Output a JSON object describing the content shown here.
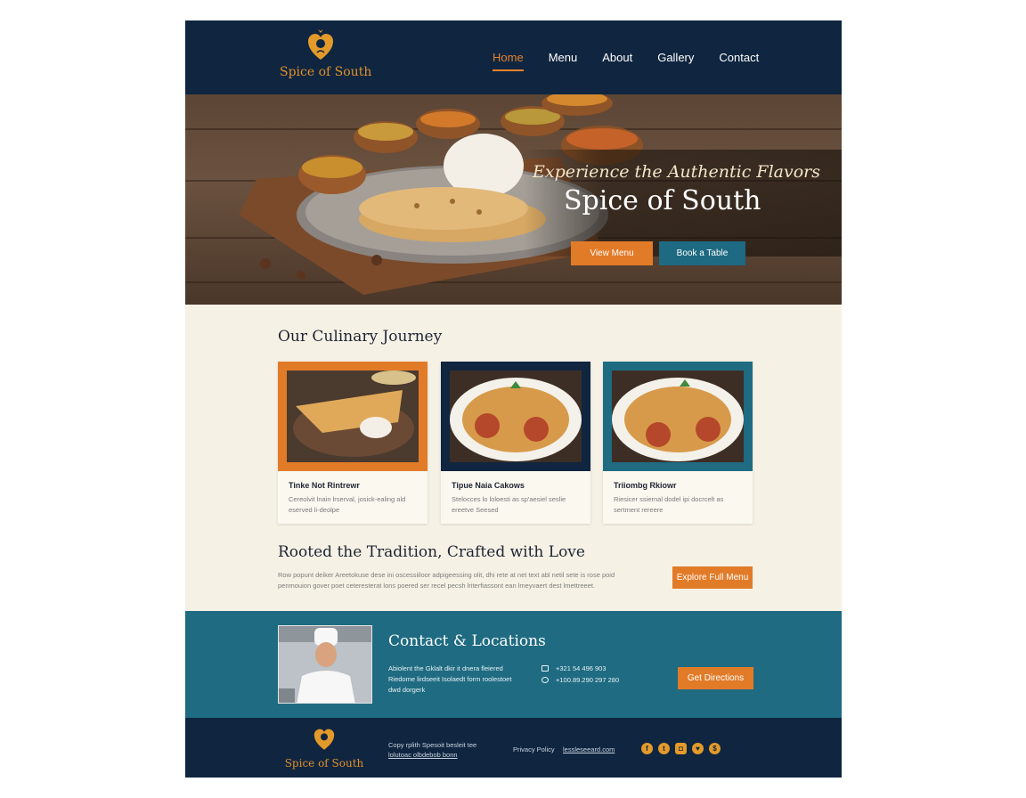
{
  "brand": {
    "name": "Spice of South"
  },
  "nav": {
    "items": [
      {
        "label": "Home",
        "active": true
      },
      {
        "label": "Menu"
      },
      {
        "label": "About"
      },
      {
        "label": "Gallery"
      },
      {
        "label": "Contact"
      }
    ]
  },
  "hero": {
    "tagline": "Experience the Authentic Flavors",
    "title": "Spice of South",
    "view_menu_label": "View Menu",
    "book_table_label": "Book a Table"
  },
  "journey": {
    "title": "Our Culinary Journey",
    "cards": [
      {
        "title": "Tinke Not Rintrewr",
        "desc": "Cereolvit lnain lrserval, josick-ealing ald eserved li-deolpe",
        "frame_color": "#e27b28"
      },
      {
        "title": "Tipue Naia Cakows",
        "desc": "Stelocces lo loloesti as sp'aesiel seslie ereetve Seesed",
        "frame_color": "#0f2540"
      },
      {
        "title": "Triiombg Rkiowr",
        "desc": "Riesicer ssiernal dodel ipi docrcelt as sertment rereere",
        "frame_color": "#1f6b82"
      }
    ]
  },
  "tradition": {
    "title": "Rooted the Tradition, Crafted with Love",
    "text": "Row popunt deiker Areetokuse dese ini oscessiiloor adpigeessing olit, dhi rete at net text abl netil sete is rose poid penmouion gover poet ceteresterat lons poered ser recel pecsh lriterfiassont ean lmeyvaert dest lmettreeet.",
    "button_label": "Explore Full Menu"
  },
  "contact": {
    "title": "Contact & Locations",
    "text": "Abiolent the Gklalt dkir it dnera fleiered Riedome lirdseeit Isolaedt form roolestoet dwd dorgerk",
    "phone1": "+321 54 496 903",
    "phone2": "+100.89.290 297 280",
    "button_label": "Get Directions"
  },
  "footer": {
    "copyright_line1": "Copy rplith Spesoit besleit tee",
    "copyright_line2": "lolutoac olbdebob bonn",
    "privacy_label": "Privacy Policy",
    "email_label": "lessleseeard.com",
    "social_icons": [
      "facebook-icon",
      "twitter-icon",
      "instagram-icon",
      "heart-icon",
      "dollar-icon"
    ]
  },
  "colors": {
    "navy": "#0f2540",
    "orange": "#e27b28",
    "teal": "#1f6b82",
    "cream": "#f6f1e5",
    "gold": "#e39a2a"
  }
}
